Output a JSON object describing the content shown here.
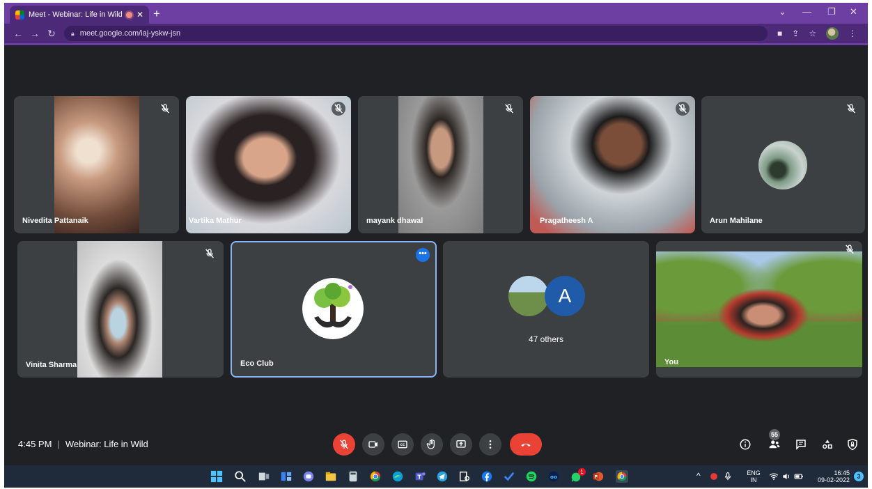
{
  "browser": {
    "tab_title": "Meet - Webinar: Life in Wild",
    "url": "meet.google.com/iaj-yskw-jsn",
    "accent": "#6d3fa3"
  },
  "participants": [
    {
      "name": "Nivedita Pattanaik",
      "muted": true
    },
    {
      "name": "Vartika Mathur",
      "muted": true
    },
    {
      "name": "mayank dhawal",
      "muted": true
    },
    {
      "name": "Pragatheesh A",
      "muted": true
    },
    {
      "name": "Arun Mahilane",
      "muted": true
    },
    {
      "name": "Vinita Sharma",
      "muted": true
    },
    {
      "name": "Eco Club",
      "muted": false
    },
    {
      "name": "You",
      "muted": true
    }
  ],
  "others": {
    "avatar_letter": "A",
    "label": "47 others"
  },
  "meeting": {
    "time": "4:45 PM",
    "separator": "|",
    "title": "Webinar: Life in Wild"
  },
  "controls": [
    "mic-off",
    "camera",
    "captions",
    "raise-hand",
    "present",
    "more",
    "end-call"
  ],
  "side_controls": {
    "people_count": "55"
  },
  "taskbar": {
    "language": "ENG",
    "region": "IN",
    "time": "16:45",
    "date": "09-02-2022",
    "whatsapp_badge": "1",
    "notification_count": "3"
  },
  "colors": {
    "meet_bg": "#202124",
    "tile_bg": "#3c4043",
    "end_call": "#ea4335",
    "active_border": "#8ab4f8"
  }
}
